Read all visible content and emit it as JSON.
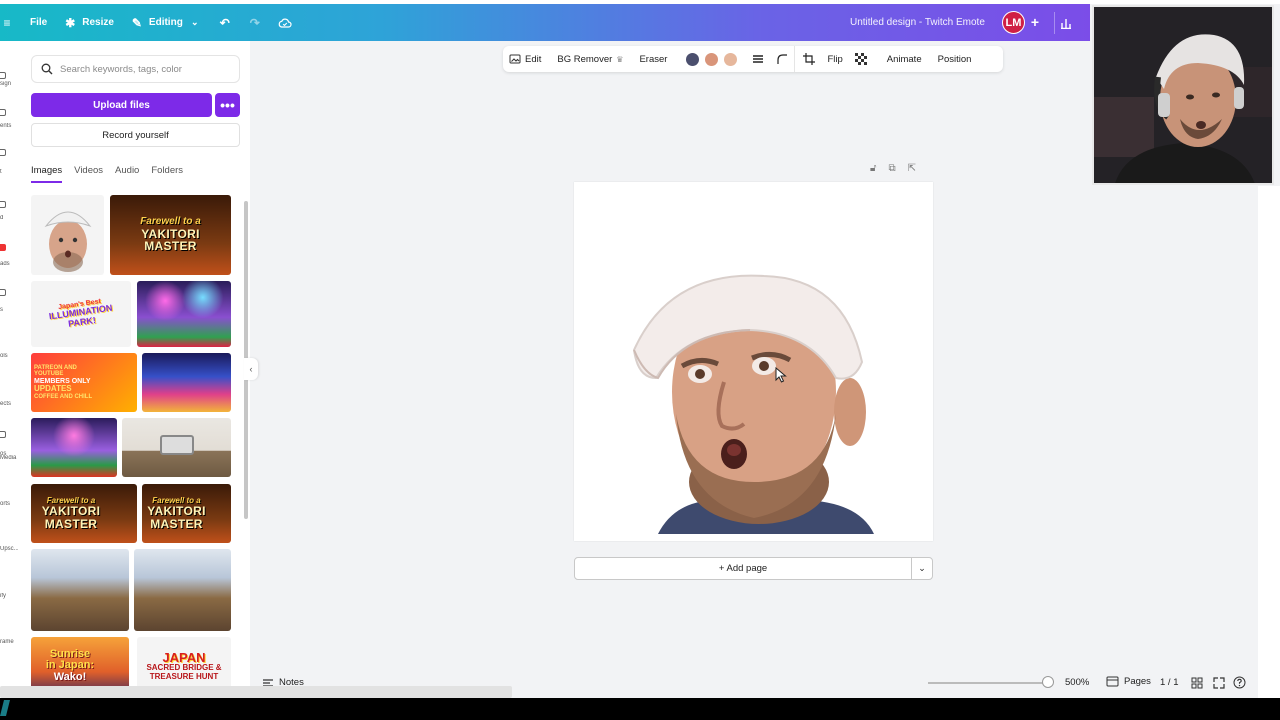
{
  "topbar": {
    "file_label": "File",
    "resize_label": "Resize",
    "editing_label": "Editing",
    "title": "Untitled design - Twitch Emote",
    "avatar_initials": "LM",
    "gradient_start": "#17b9c7",
    "gradient_end": "#7b4de8"
  },
  "rail": {
    "items": [
      "sign",
      "ents",
      "t",
      "d",
      "ads",
      "s",
      "ols",
      "ects",
      "os",
      "Media",
      "orts",
      "Upsc...",
      "ify",
      "rame"
    ]
  },
  "panel": {
    "search_placeholder": "Search keywords, tags, color",
    "upload_label": "Upload files",
    "more_label": "•••",
    "record_label": "Record yourself",
    "tabs": [
      {
        "label": "Images",
        "active": true
      },
      {
        "label": "Videos",
        "active": false
      },
      {
        "label": "Audio",
        "active": false
      },
      {
        "label": "Folders",
        "active": false
      }
    ],
    "thumbs": {
      "yakitori_line1": "Farewell to a",
      "yakitori_line2": "YAKITORI",
      "yakitori_line3": "MASTER",
      "illum_line1": "Japan's Best",
      "illum_line2": "ILLUMINATION",
      "illum_line3": "PARK!",
      "members_line1": "PATREON AND YOUTUBE",
      "members_line2": "MEMBERS ONLY",
      "members_line3": "UPDATES",
      "members_line4": "COFFEE AND CHILL",
      "sunrise_line1": "Sunrise",
      "sunrise_line2": "in Japan:",
      "sunrise_line3": "Wako!",
      "japan_line1": "JAPAN",
      "japan_line2": "SACRED BRIDGE &",
      "japan_line3": "TREASURE HUNT"
    },
    "accent": "#7d2ae8"
  },
  "context_toolbar": {
    "edit_label": "Edit",
    "bg_remover_label": "BG Remover",
    "eraser_label": "Eraser",
    "colors": [
      "#4b4f6e",
      "#d9957a",
      "#e6b79c"
    ],
    "flip_label": "Flip",
    "animate_label": "Animate",
    "position_label": "Position"
  },
  "canvas": {
    "add_page_label": "+ Add page"
  },
  "bottombar": {
    "notes_label": "Notes",
    "zoom": "500%",
    "pages_label": "Pages",
    "page_count": "1 / 1"
  }
}
